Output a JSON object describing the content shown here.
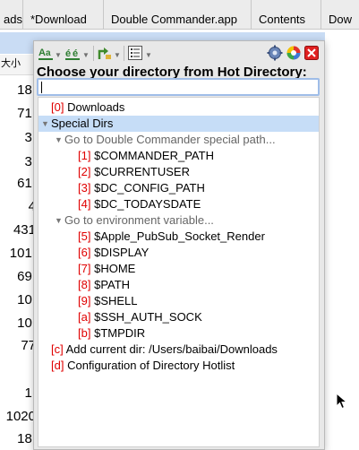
{
  "tabs": [
    "ads",
    "*Download",
    "Double Commander.app",
    "Contents",
    "Dow"
  ],
  "column_header": "大小",
  "background_numbers": [
    "18.",
    "71.",
    "3.",
    "3.",
    "61.",
    "4",
    "431",
    "101.",
    "69.",
    "10.",
    "10.",
    "77",
    "1.",
    "1020",
    "18."
  ],
  "popup": {
    "title": "Choose your directory from Hot Directory:",
    "search_value": "",
    "colors": {
      "key": "#e00000",
      "selection": "#c6ddf7",
      "search_border": "#9fbde8"
    }
  },
  "tree": {
    "downloads": {
      "key": "[0]",
      "label": "Downloads"
    },
    "special_dirs": {
      "label": "Special Dirs"
    },
    "dc_group": {
      "label": "Go to Double Commander special path..."
    },
    "dc_items": [
      {
        "key": "[1]",
        "label": "$COMMANDER_PATH"
      },
      {
        "key": "[2]",
        "label": "$CURRENTUSER"
      },
      {
        "key": "[3]",
        "label": "$DC_CONFIG_PATH"
      },
      {
        "key": "[4]",
        "label": "$DC_TODAYSDATE"
      }
    ],
    "env_group": {
      "label": "Go to environment variable..."
    },
    "env_items": [
      {
        "key": "[5]",
        "label": "$Apple_PubSub_Socket_Render"
      },
      {
        "key": "[6]",
        "label": "$DISPLAY"
      },
      {
        "key": "[7]",
        "label": "$HOME"
      },
      {
        "key": "[8]",
        "label": "$PATH"
      },
      {
        "key": "[9]",
        "label": "$SHELL"
      },
      {
        "key": "[a]",
        "label": "$SSH_AUTH_SOCK"
      },
      {
        "key": "[b]",
        "label": "$TMPDIR"
      }
    ],
    "add_current": {
      "key": "[c]",
      "label": "Add current dir: /Users/baibai/Downloads"
    },
    "configure": {
      "key": "[d]",
      "label": "Configuration of Directory Hotlist"
    }
  }
}
